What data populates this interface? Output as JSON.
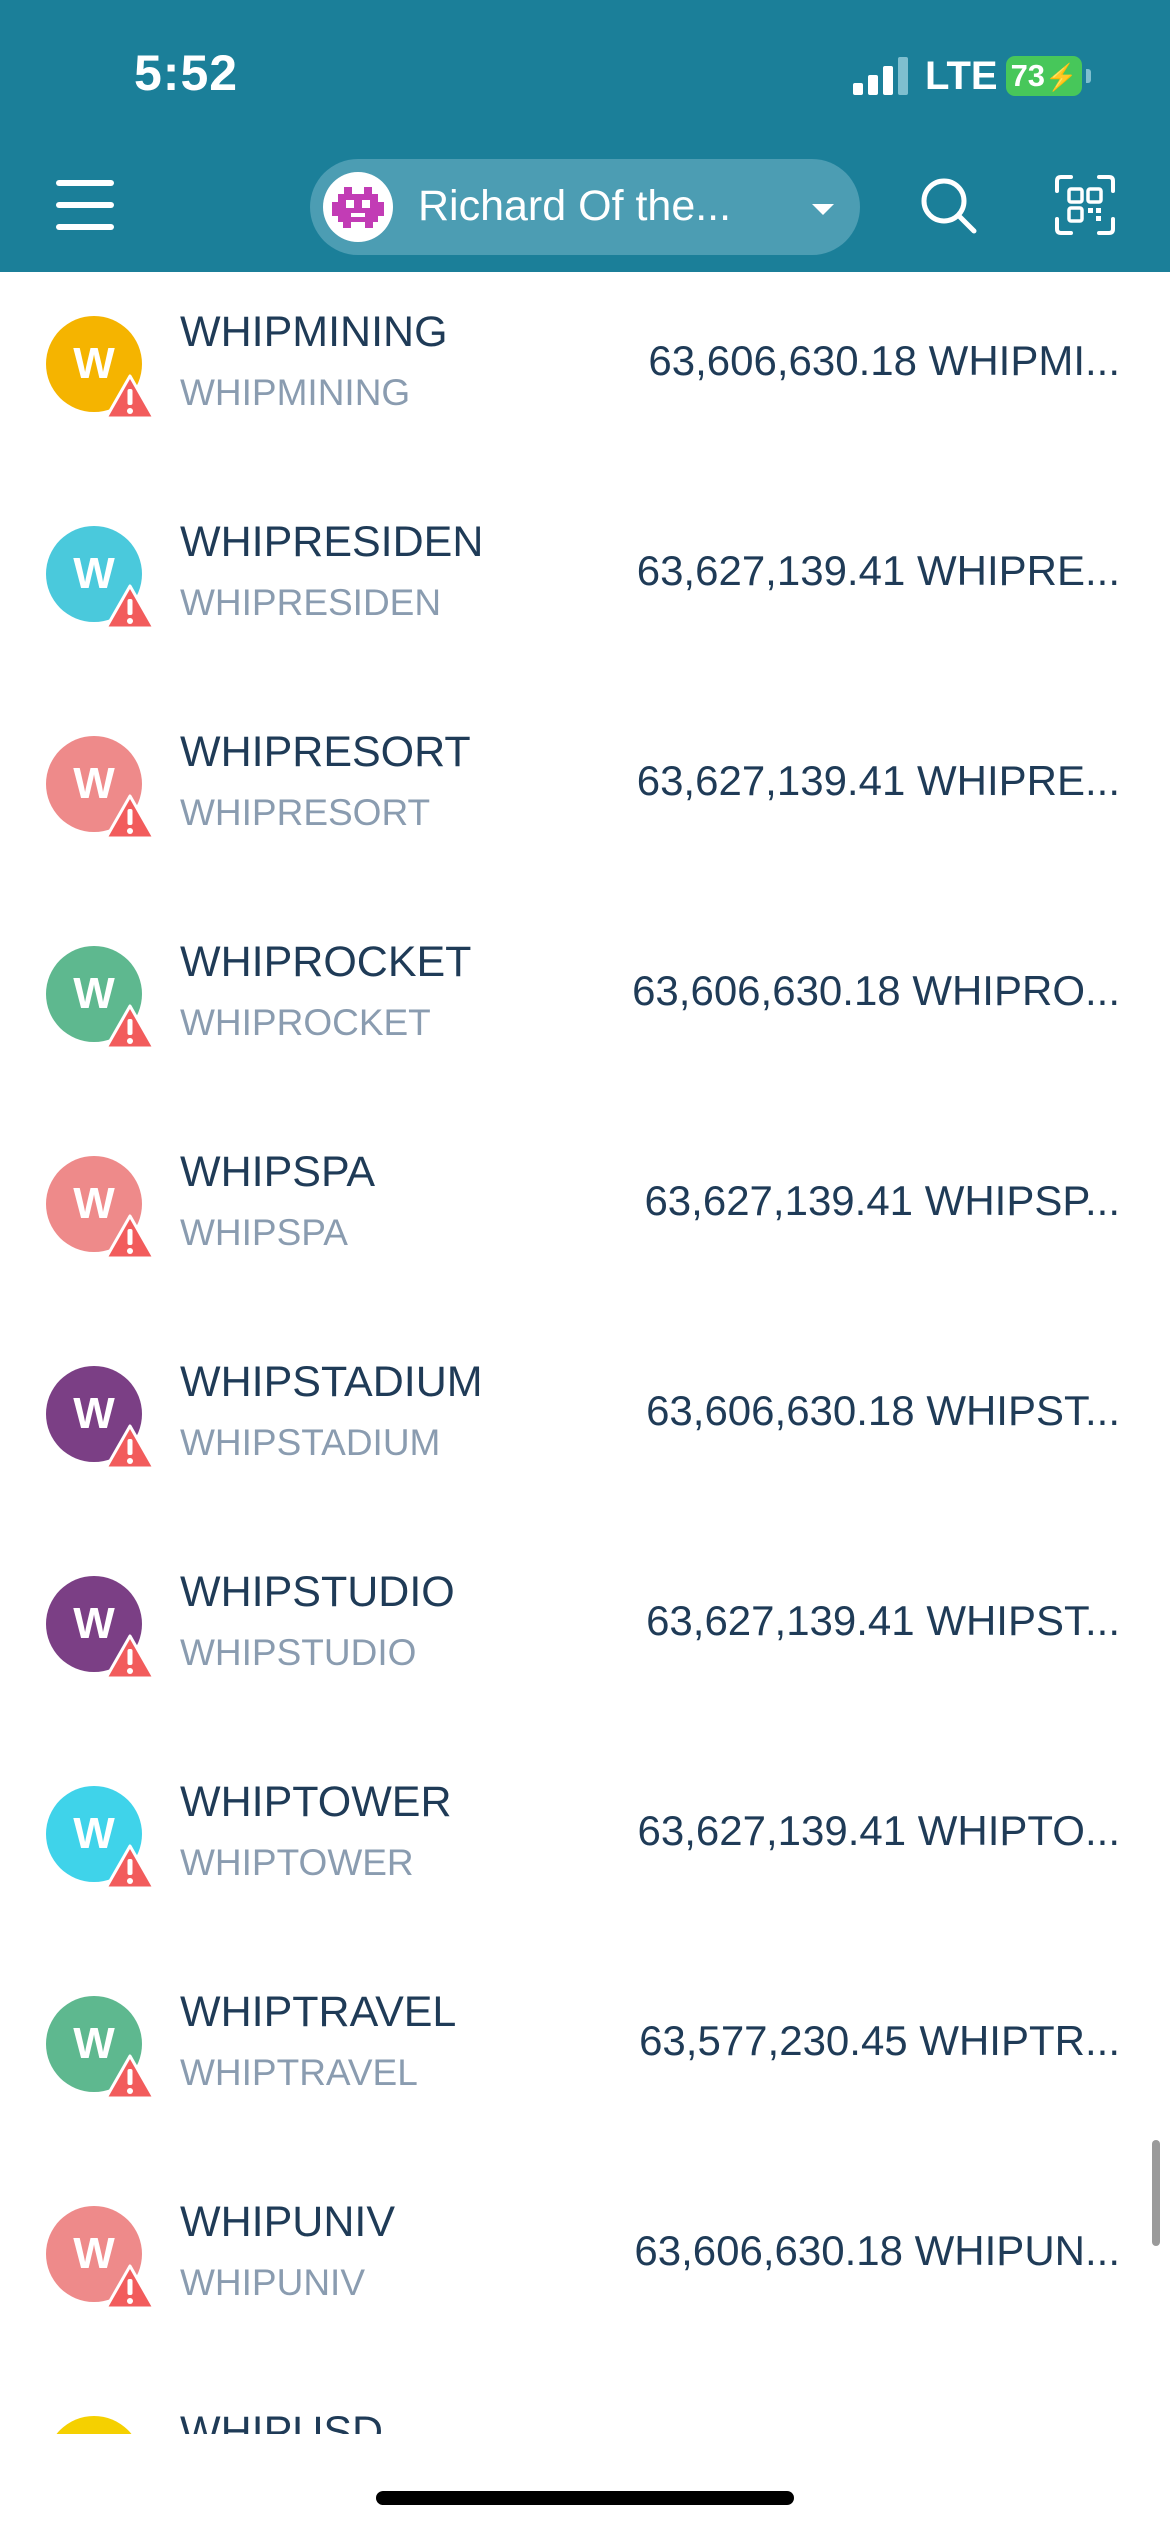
{
  "status_bar": {
    "time": "5:52",
    "network": "LTE",
    "battery": "73"
  },
  "header": {
    "account_name": "Richard Of the...",
    "colors": {
      "bar": "#1b7f99",
      "pill": "#4c9db3"
    }
  },
  "tokens": [
    {
      "name": "WHIPMINING",
      "symbol": "WHIPMINING",
      "balance": "63,606,630.18 WHIPMI...",
      "color": "#f5b400"
    },
    {
      "name": "WHIPRESIDEN",
      "symbol": "WHIPRESIDEN",
      "balance": "63,627,139.41 WHIPRE...",
      "color": "#4ac9dc"
    },
    {
      "name": "WHIPRESORT",
      "symbol": "WHIPRESORT",
      "balance": "63,627,139.41 WHIPRE...",
      "color": "#ee8a8a"
    },
    {
      "name": "WHIPROCKET",
      "symbol": "WHIPROCKET",
      "balance": "63,606,630.18 WHIPRO...",
      "color": "#5eb88f"
    },
    {
      "name": "WHIPSPA",
      "symbol": "WHIPSPA",
      "balance": "63,627,139.41 WHIPSP...",
      "color": "#ee8a8a"
    },
    {
      "name": "WHIPSTADIUM",
      "symbol": "WHIPSTADIUM",
      "balance": "63,606,630.18 WHIPST...",
      "color": "#7b3f85"
    },
    {
      "name": "WHIPSTUDIO",
      "symbol": "WHIPSTUDIO",
      "balance": "63,627,139.41 WHIPST...",
      "color": "#7b3f85"
    },
    {
      "name": "WHIPTOWER",
      "symbol": "WHIPTOWER",
      "balance": "63,627,139.41 WHIPTO...",
      "color": "#3fd3ea"
    },
    {
      "name": "WHIPTRAVEL",
      "symbol": "WHIPTRAVEL",
      "balance": "63,577,230.45 WHIPTR...",
      "color": "#5eb88f"
    },
    {
      "name": "WHIPUNIV",
      "symbol": "WHIPUNIV",
      "balance": "63,606,630.18 WHIPUN...",
      "color": "#ee8a8a"
    },
    {
      "name": "WHIPUSD",
      "symbol": "",
      "balance": "",
      "color": "#f5d000"
    }
  ],
  "token_icon_letter": "W",
  "warning_color": "#f25c5c"
}
